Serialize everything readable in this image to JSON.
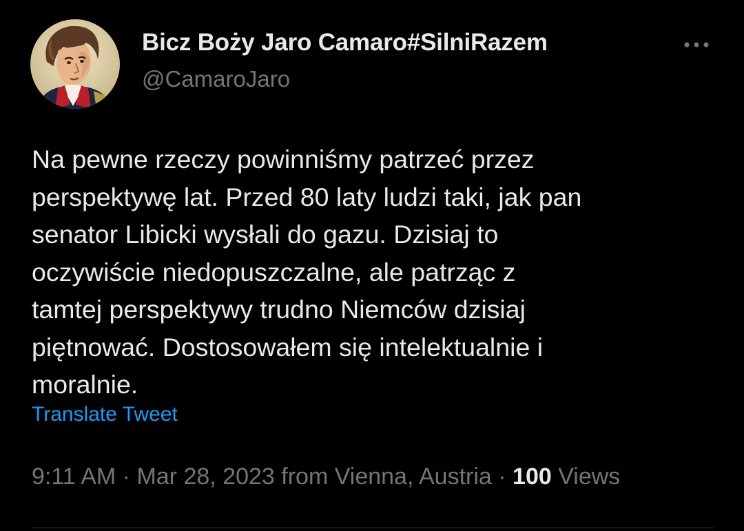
{
  "author": {
    "display_name": "Bicz Boży Jaro Camaro#SilniRazem",
    "handle": "@CamaroJaro"
  },
  "more_icon": "more-horizontal-icon",
  "tweet": {
    "lines": [
      "Na pewne rzeczy powinniśmy patrzeć przez",
      "perspektywę lat. Przed 80 laty ludzi taki, jak pan",
      "senator Libicki wysłali do gazu. Dzisiaj to",
      "oczywiście niedopuszczalne, ale patrząc z",
      "tamtej perspektywy trudno Niemców dzisiaj",
      "piętnować. Dostosowałem się intelektualnie i",
      "moralnie."
    ],
    "translate_label": "Translate Tweet"
  },
  "meta": {
    "time": "9:11 AM",
    "separator": " · ",
    "date": "Mar 28, 2023",
    "source": "from Vienna, Austria",
    "views_count": "100",
    "views_label": "Views"
  },
  "colors": {
    "background": "#000000",
    "primary_text": "#e7e9ea",
    "secondary_text": "#71767b",
    "link": "#1d9bf0",
    "divider": "#2f3336"
  }
}
